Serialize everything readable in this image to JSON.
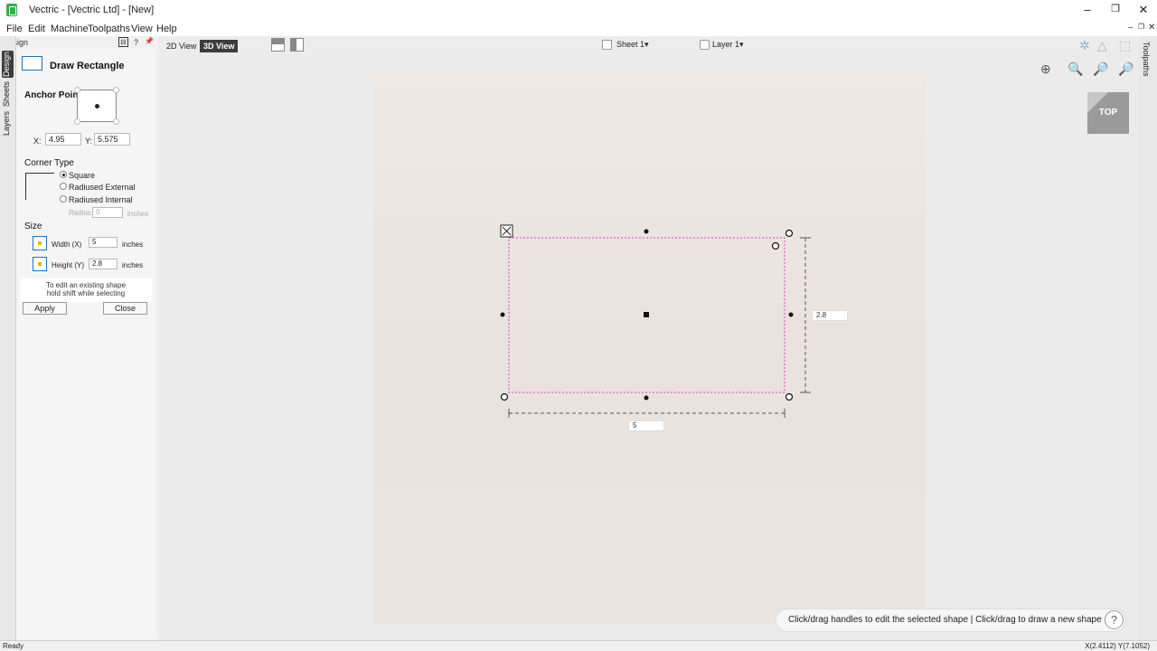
{
  "window": {
    "title": "Vectric - [Vectric Ltd] - [New]",
    "controls": {
      "minimize": "–",
      "restore": "❐",
      "close": "✕"
    },
    "mdi_controls": {
      "minimize": "–",
      "restore": "❐",
      "close": "✕"
    }
  },
  "menu": [
    "File",
    "Edit",
    "Machine",
    "Toolpaths",
    "View",
    "Help"
  ],
  "left_tabs": [
    "Design",
    "Sheets",
    "Layers"
  ],
  "design_header": {
    "label": "Design",
    "help": "?",
    "pin": "📌",
    "layout_icon": "⊟"
  },
  "panel": {
    "title": "Draw Rectangle",
    "anchor_label": "Anchor Point",
    "x_label": "X:",
    "x_value": "4.95",
    "y_label": "Y:",
    "y_value": "5.575",
    "corner_label": "Corner Type",
    "corner_options": [
      "Square",
      "Radiused External",
      "Radiused Internal"
    ],
    "corner_selected": "Square",
    "radius_label": "Radius",
    "radius_value": "0",
    "radius_unit": "inches",
    "size_label": "Size",
    "width_label": "Width (X)",
    "width_value": "5",
    "width_unit": "inches",
    "height_label": "Height (Y)",
    "height_value": "2.8",
    "height_unit": "inches",
    "hint_line1": "To edit an existing shape",
    "hint_line2": "hold shift while selecting",
    "apply_label": "Apply",
    "close_label": "Close"
  },
  "view": {
    "tab_2d": "2D View",
    "tab_3d": "3D View",
    "active_tab": "3D View",
    "sheet_label": "Sheet 1",
    "layer_label": "Layer 1",
    "dropdown_arrow": "▾"
  },
  "canvas": {
    "width_dim": "5",
    "height_dim": "2.8",
    "view_cube_label": "TOP",
    "selection_color": "#e040c8"
  },
  "right_tabs": [
    "Toolpaths"
  ],
  "hint_bar": {
    "text": "Click/drag handles to edit the selected shape | Click/drag to draw a new shape",
    "help": "?"
  },
  "status": {
    "left": "Ready",
    "right": "X(2.4112) Y(7.1052)"
  },
  "icons": {
    "rect_icon": "▭",
    "shapes": "⧉",
    "layers": "◈",
    "plane": "▱",
    "box": "⬡",
    "anchor": "⚓",
    "toolpath": "⫴",
    "zoom_extents": "⊕",
    "zoom_in": "🔍",
    "zoom_sel": "🔎"
  }
}
